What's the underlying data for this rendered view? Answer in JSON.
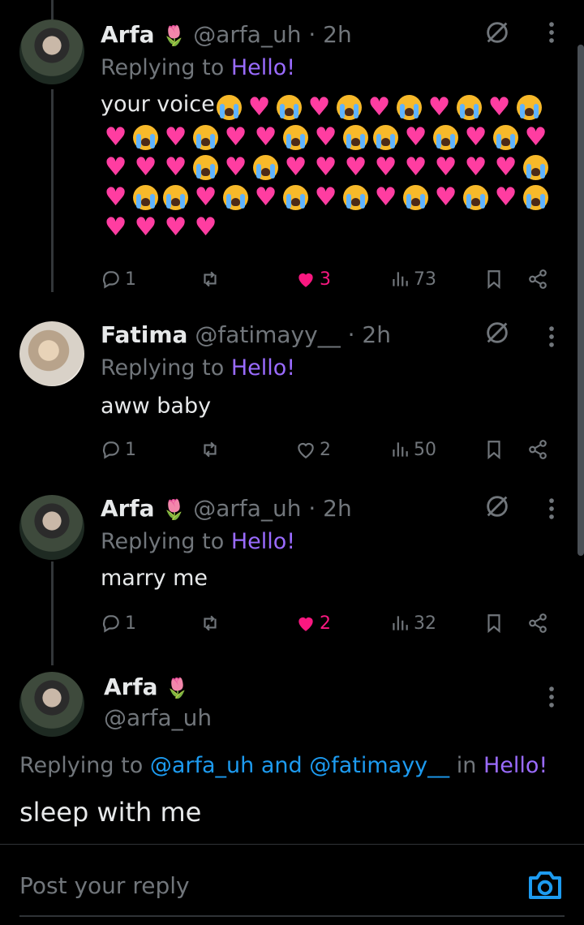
{
  "replies": [
    {
      "name": "Arfa",
      "handle": "@arfa_uh",
      "time": "· 2h",
      "replying_prefix": "Replying to ",
      "replying_to": "Hello!",
      "text": "your voice",
      "emoji_rows": [
        [
          "cry",
          "heart",
          "cry",
          "heart",
          "cry",
          "heart",
          "cry",
          "heart",
          "cry",
          "heart",
          "cry"
        ],
        [
          "heart",
          "cry",
          "heart",
          "cry",
          "heart",
          "heart",
          "cry",
          "heart",
          "cry",
          "cry",
          "heart",
          "cry",
          "heart",
          "cry",
          "heart"
        ],
        [
          "heart",
          "heart",
          "heart",
          "cry",
          "heart",
          "cry",
          "heart",
          "heart",
          "heart",
          "heart",
          "heart",
          "heart",
          "heart",
          "heart",
          "cry"
        ],
        [
          "heart",
          "cry",
          "cry",
          "heart",
          "cry",
          "heart",
          "cry",
          "heart",
          "cry",
          "heart",
          "cry",
          "heart",
          "cry",
          "heart",
          "cry"
        ],
        [
          "heart",
          "heart",
          "heart",
          "heart"
        ]
      ],
      "replies": "1",
      "likes": "3",
      "liked": true,
      "views": "73"
    },
    {
      "name": "Fatima",
      "handle": "@fatimayy__",
      "time": "· 2h",
      "replying_prefix": "Replying to ",
      "replying_to": "Hello!",
      "text": "aww baby",
      "replies": "1",
      "likes": "2",
      "liked": false,
      "views": "50"
    },
    {
      "name": "Arfa",
      "handle": "@arfa_uh",
      "time": "· 2h",
      "replying_prefix": "Replying to ",
      "replying_to": "Hello!",
      "text": "marry me",
      "replies": "1",
      "likes": "2",
      "liked": true,
      "views": "32"
    }
  ],
  "main": {
    "name": "Arfa",
    "handle": "@arfa_uh",
    "replying_prefix": "Replying to ",
    "mention1": "@arfa_uh",
    "and": " and ",
    "mention2": "@fatimayy__",
    "in": " in ",
    "thread": "Hello!",
    "text": "sleep with me"
  },
  "composer": {
    "placeholder": "Post your reply"
  },
  "colors": {
    "accent_link": "#9a6bff",
    "mention": "#1d9bf0",
    "like": "#f91880",
    "background": "#000000"
  }
}
